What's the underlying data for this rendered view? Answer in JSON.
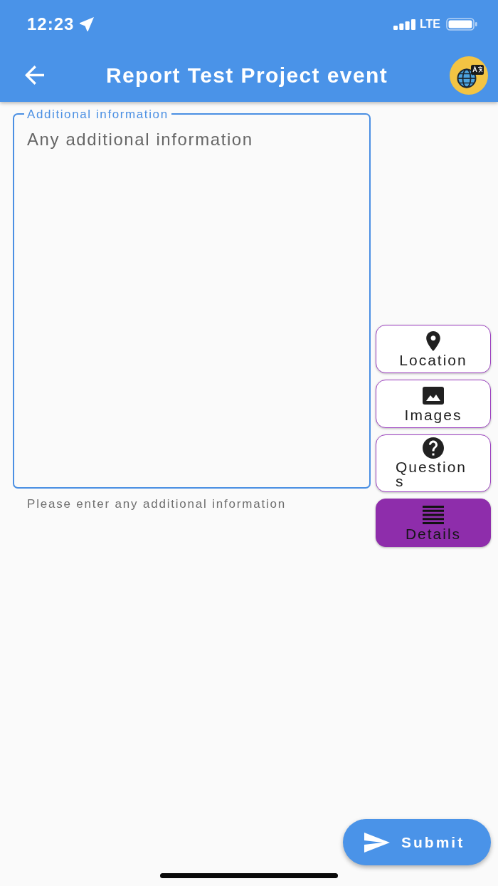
{
  "status_bar": {
    "time": "12:23",
    "network": "LTE"
  },
  "app_bar": {
    "title": "Report Test Project event"
  },
  "form": {
    "field": {
      "label": "Additional information",
      "placeholder": "Any additional information",
      "helper": "Please enter any additional information"
    }
  },
  "side_tabs": [
    {
      "label": "Location",
      "kind": "location",
      "selected": false
    },
    {
      "label": "Images",
      "kind": "images",
      "selected": false
    },
    {
      "label": "Questions",
      "kind": "questions",
      "selected": false
    },
    {
      "label": "Details",
      "kind": "details",
      "selected": true
    }
  ],
  "submit_button": {
    "label": "Submit"
  }
}
